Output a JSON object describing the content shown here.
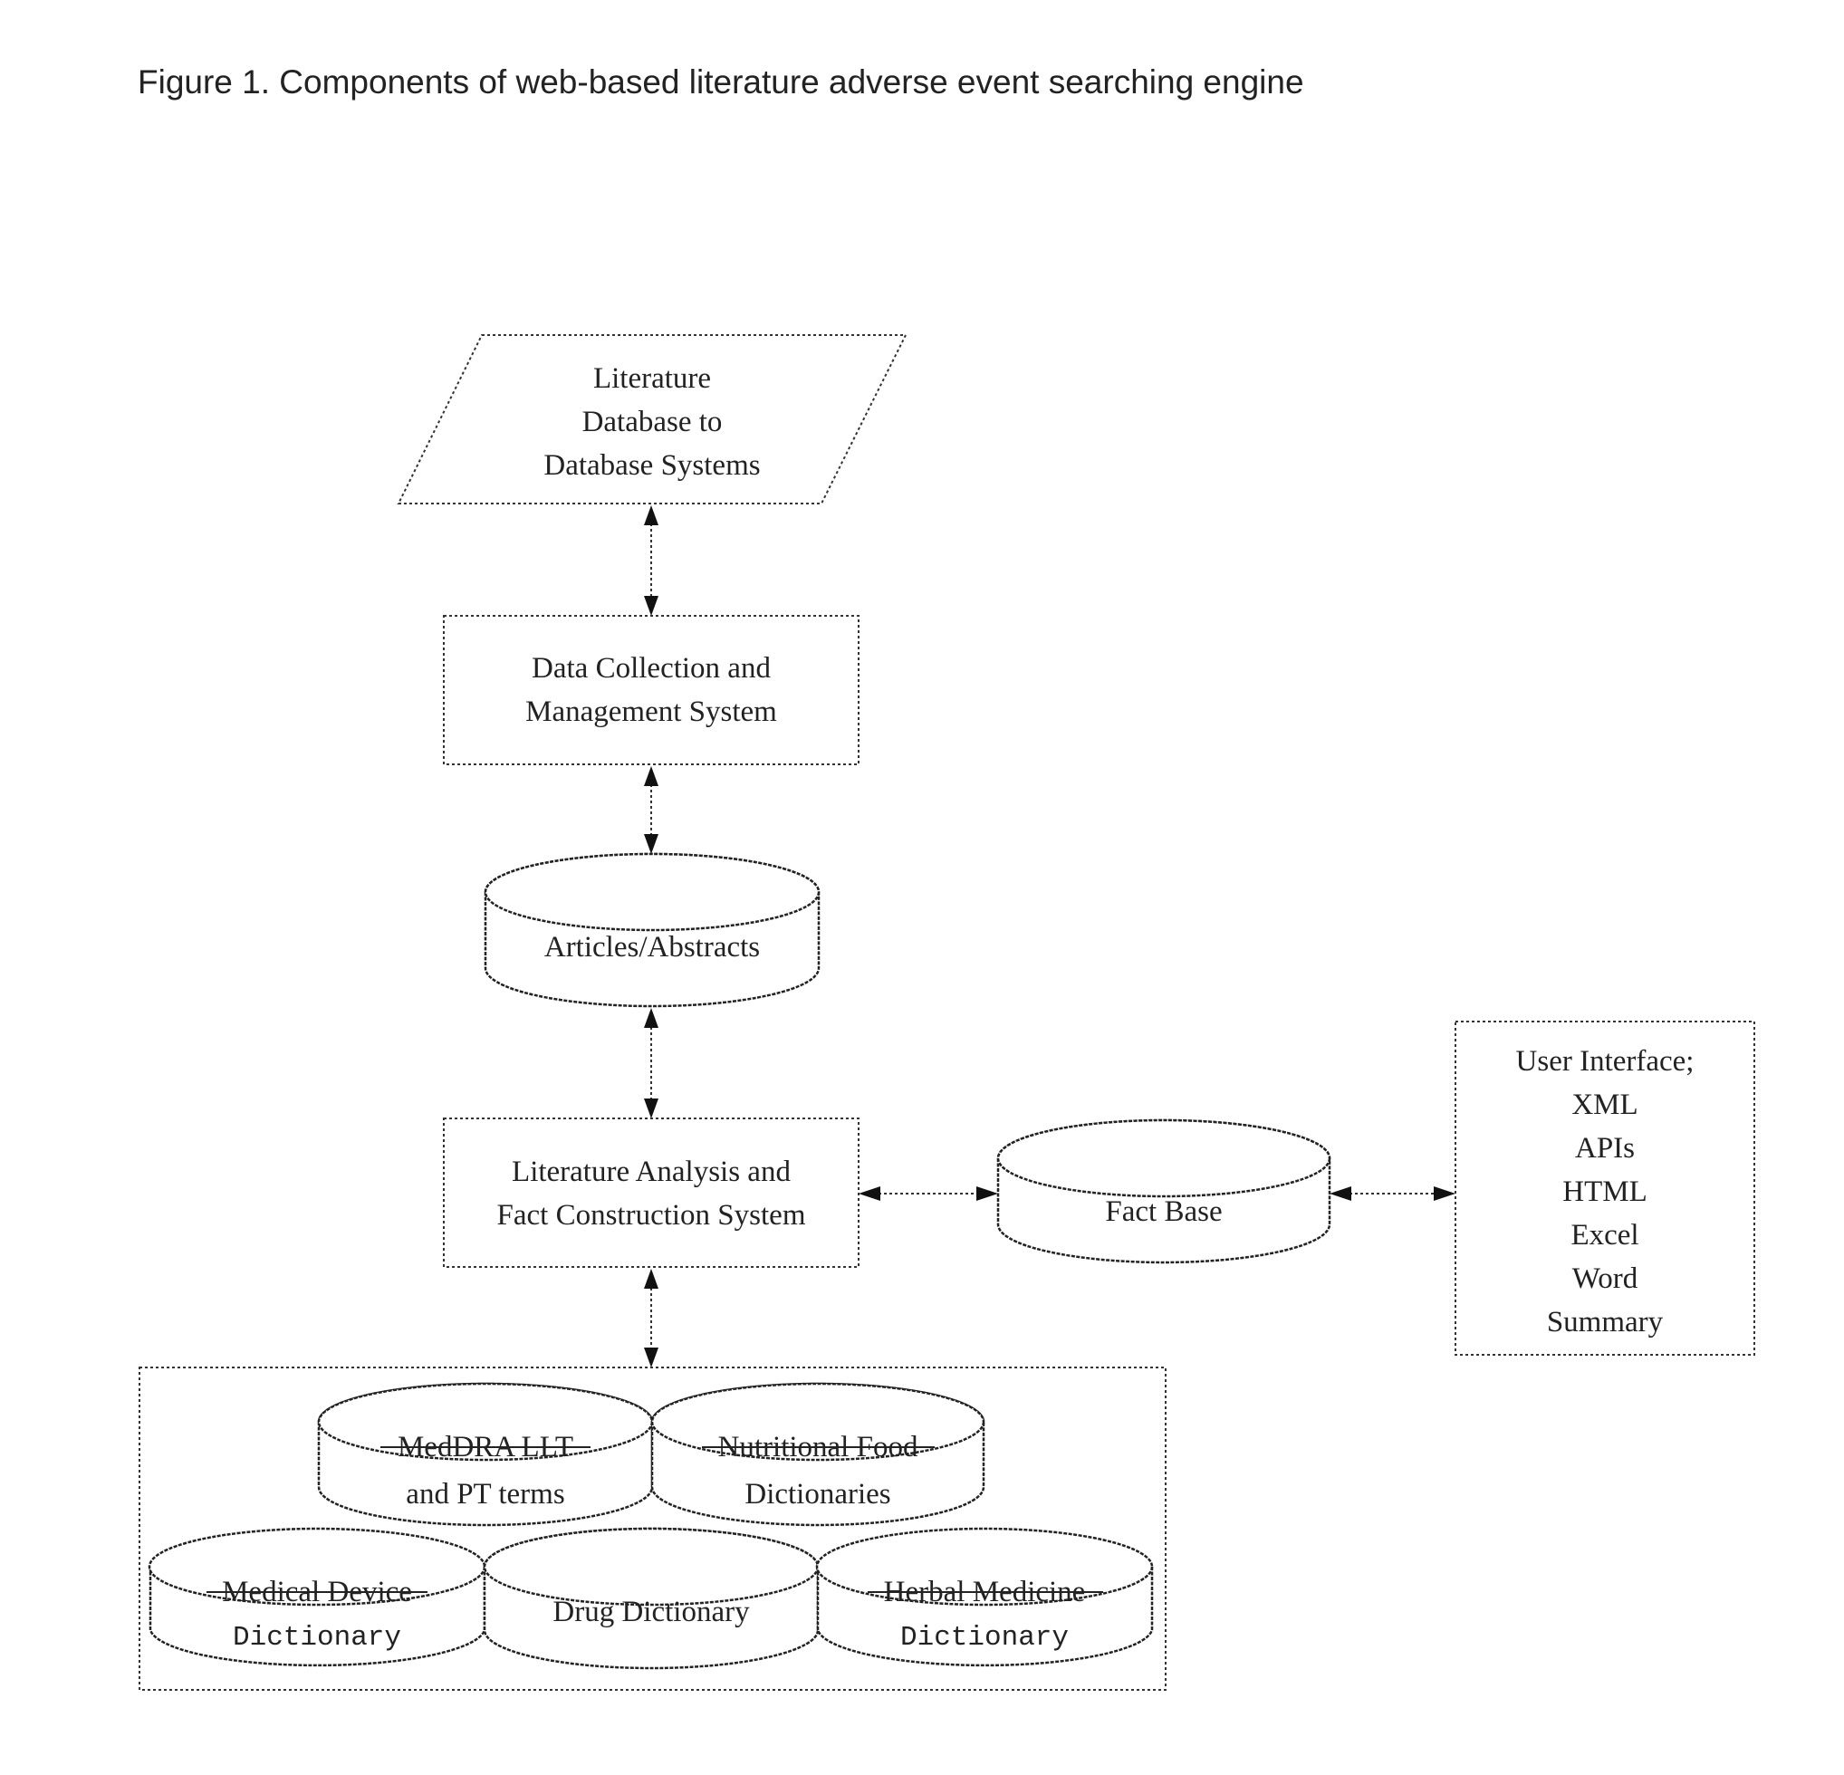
{
  "figure": {
    "title": "Figure 1. Components of web-based literature adverse event searching engine"
  },
  "nodes": {
    "literature_database": {
      "lines": [
        "Literature",
        "Database to",
        "Database Systems"
      ],
      "shape": "parallelogram"
    },
    "data_collection": {
      "lines": [
        "Data Collection and",
        "Management System"
      ],
      "shape": "rectangle"
    },
    "articles": {
      "lines": [
        "Articles/Abstracts"
      ],
      "shape": "cylinder"
    },
    "literature_analysis": {
      "lines": [
        "Literature Analysis and",
        "Fact Construction System"
      ],
      "shape": "rectangle"
    },
    "fact_base": {
      "lines": [
        "Fact Base"
      ],
      "shape": "cylinder"
    },
    "user_interface": {
      "lines": [
        "User Interface;",
        "XML",
        "APIs",
        "HTML",
        "Excel",
        "Word",
        "Summary"
      ],
      "shape": "rectangle"
    },
    "dictionaries": {
      "shape": "group",
      "items": [
        {
          "lines": [
            "MedDRA LLT",
            "and PT terms"
          ],
          "struck_first_line": true
        },
        {
          "lines": [
            "Nutritional Food",
            "Dictionaries"
          ],
          "struck_first_line": true
        },
        {
          "lines": [
            "Medical Device",
            "Dictionary"
          ],
          "struck_first_line": true
        },
        {
          "lines": [
            "Drug Dictionary"
          ],
          "struck_first_line": false
        },
        {
          "lines": [
            "Herbal Medicine",
            "Dictionary"
          ],
          "struck_first_line": true
        }
      ]
    }
  },
  "edges": [
    {
      "from": "literature_database",
      "to": "data_collection",
      "direction": "bidirectional"
    },
    {
      "from": "data_collection",
      "to": "articles",
      "direction": "bidirectional"
    },
    {
      "from": "articles",
      "to": "literature_analysis",
      "direction": "bidirectional"
    },
    {
      "from": "literature_analysis",
      "to": "dictionaries",
      "direction": "bidirectional"
    },
    {
      "from": "literature_analysis",
      "to": "fact_base",
      "direction": "bidirectional"
    },
    {
      "from": "fact_base",
      "to": "user_interface",
      "direction": "bidirectional"
    }
  ]
}
